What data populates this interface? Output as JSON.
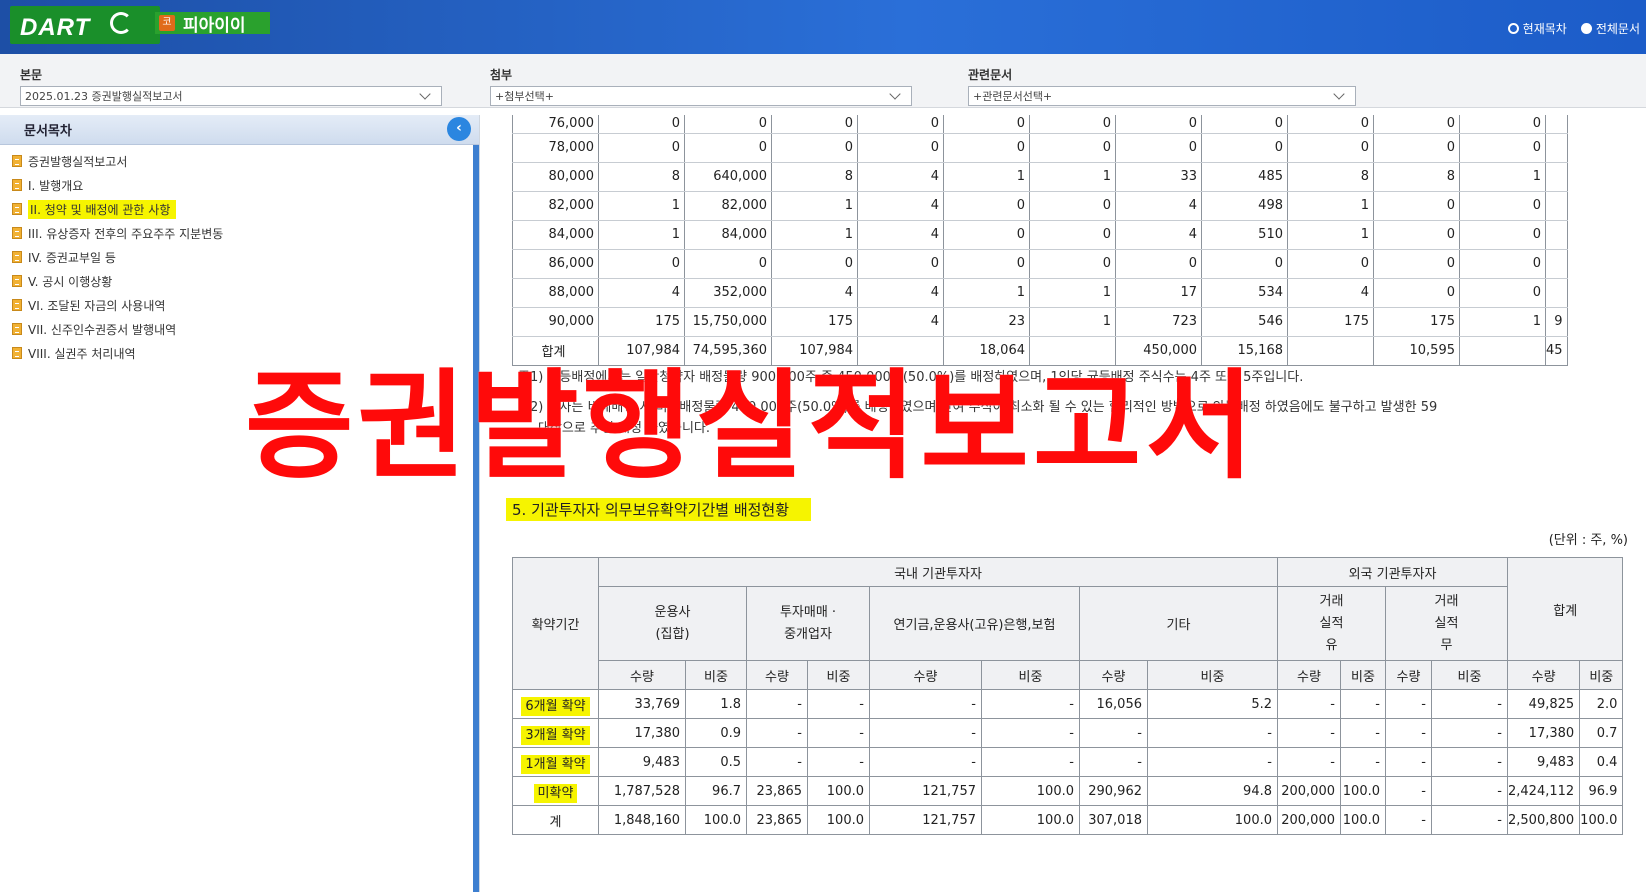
{
  "header": {
    "logo": "DART",
    "company_badge": "코",
    "company": "피아이이",
    "scope_options": [
      "현재목차",
      "전체문서"
    ]
  },
  "selectors": {
    "main": {
      "label": "본문",
      "value": "2025.01.23  증권발행실적보고서"
    },
    "attach": {
      "label": "첨부",
      "value": "+첨부선택+"
    },
    "related": {
      "label": "관련문서",
      "value": "+관련문서선택+"
    }
  },
  "sidebar": {
    "title": "문서목차",
    "items": [
      {
        "label": "증권발행실적보고서"
      },
      {
        "label": "I. 발행개요"
      },
      {
        "label": "II. 청약 및 배정에 관한 사항"
      },
      {
        "label": "III. 유상증자 전후의 주요주주 지분변동"
      },
      {
        "label": "IV. 증권교부일 등"
      },
      {
        "label": "V. 공시 이행상황"
      },
      {
        "label": "VI. 조달된 자금의 사용내역"
      },
      {
        "label": "VII. 신주인수권증서 발행내역"
      },
      {
        "label": "VIII. 실권주 처리내역"
      }
    ]
  },
  "table1": {
    "rows": [
      [
        "76,000",
        "0",
        "0",
        "0",
        "0",
        "0",
        "0",
        "0",
        "0",
        "0",
        "0",
        "0",
        ""
      ],
      [
        "78,000",
        "0",
        "0",
        "0",
        "0",
        "0",
        "0",
        "0",
        "0",
        "0",
        "0",
        "0",
        ""
      ],
      [
        "80,000",
        "8",
        "640,000",
        "8",
        "4",
        "1",
        "1",
        "33",
        "485",
        "8",
        "8",
        "1",
        ""
      ],
      [
        "82,000",
        "1",
        "82,000",
        "1",
        "4",
        "0",
        "0",
        "4",
        "498",
        "1",
        "0",
        "0",
        ""
      ],
      [
        "84,000",
        "1",
        "84,000",
        "1",
        "4",
        "0",
        "0",
        "4",
        "510",
        "1",
        "0",
        "0",
        ""
      ],
      [
        "86,000",
        "0",
        "0",
        "0",
        "0",
        "0",
        "0",
        "0",
        "0",
        "0",
        "0",
        "0",
        ""
      ],
      [
        "88,000",
        "4",
        "352,000",
        "4",
        "4",
        "1",
        "1",
        "17",
        "534",
        "4",
        "0",
        "0",
        ""
      ],
      [
        "90,000",
        "175",
        "15,750,000",
        "175",
        "4",
        "23",
        "1",
        "723",
        "546",
        "175",
        "175",
        "1",
        "9"
      ],
      [
        "합계",
        "107,984",
        "74,595,360",
        "107,984",
        "",
        "18,064",
        "",
        "450,000",
        "15,168",
        "",
        "10,595",
        "",
        "45"
      ]
    ]
  },
  "notes": {
    "n1": "주1) 균등배정에서는 일반청약자 배정물량 900,000주 중 450,000주(50.0%)를 배정하였으며, 1인당 균등배정 주식수는 4주 또는 5주입니다.",
    "n2": "주2) 당사는 비례배정 시 비례배정물량 450,000주(50.0%)를 배정하였으며 잔여 주식이 최소화 될 수 있는 합리적인 방법으로 안분배정 하였음에도 불구하고 발생한 59",
    "n3": "대상으로 추첨 배정 하였습니다."
  },
  "section5": {
    "title": "5. 기관투자자 의무보유확약기간별 배정현황",
    "unit": "(단위 : 주, %)",
    "headers": {
      "period": "확약기간",
      "domestic": "국내 기관투자자",
      "foreign": "외국 기관투자자",
      "total": "합계",
      "asset_mgr": "운용사\n(집합)",
      "broker": "투자매매 ·\n중개업자",
      "pension": "연기금,운용사(고유)은행,보험",
      "other": "기타",
      "trade_yes": "거래\n실적\n유",
      "trade_no": "거래\n실적\n무",
      "qty": "수량",
      "ratio": "비중"
    },
    "rows": [
      {
        "label": "6개월 확약",
        "values": [
          "33,769",
          "1.8",
          "-",
          "-",
          "-",
          "-",
          "16,056",
          "5.2",
          "-",
          "-",
          "-",
          "-",
          "49,825",
          "2.0"
        ]
      },
      {
        "label": "3개월 확약",
        "values": [
          "17,380",
          "0.9",
          "-",
          "-",
          "-",
          "-",
          "-",
          "-",
          "-",
          "-",
          "-",
          "-",
          "17,380",
          "0.7"
        ]
      },
      {
        "label": "1개월 확약",
        "values": [
          "9,483",
          "0.5",
          "-",
          "-",
          "-",
          "-",
          "-",
          "-",
          "-",
          "-",
          "-",
          "-",
          "9,483",
          "0.4"
        ]
      },
      {
        "label": "미확약",
        "values": [
          "1,787,528",
          "96.7",
          "23,865",
          "100.0",
          "121,757",
          "100.0",
          "290,962",
          "94.8",
          "200,000",
          "100.0",
          "-",
          "-",
          "2,424,112",
          "96.9"
        ]
      },
      {
        "label": "계",
        "values": [
          "1,848,160",
          "100.0",
          "23,865",
          "100.0",
          "121,757",
          "100.0",
          "307,018",
          "100.0",
          "200,000",
          "100.0",
          "-",
          "-",
          "2,500,800",
          "100.0"
        ]
      }
    ]
  },
  "overlay_title": "증권발행실적보고서"
}
